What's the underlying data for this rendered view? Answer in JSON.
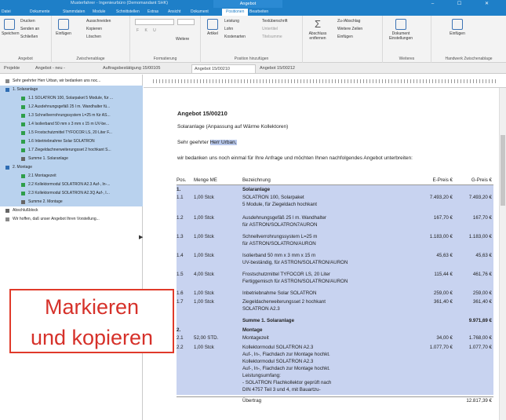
{
  "titlebar": {
    "title": "Musterfahrer - Ingenieurbüro (Demomandant SHK)",
    "context_tab": "Angebot",
    "window_controls": "–  ☐  ✕"
  },
  "tabs": [
    {
      "label": "Datei",
      "active": false
    },
    {
      "label": "Dokumente",
      "active": false
    },
    {
      "label": "Stammdaten",
      "active": false
    },
    {
      "label": "Module",
      "active": false
    },
    {
      "label": "Schnittstellen",
      "active": false
    },
    {
      "label": "Extras",
      "active": false
    },
    {
      "label": "Ansicht",
      "active": false
    },
    {
      "label": "Dokument",
      "active": false
    },
    {
      "label": "Positionen",
      "active": true
    },
    {
      "label": "Bearbeiten",
      "active": false
    }
  ],
  "ribbon": {
    "angebot": {
      "print": "Drucken",
      "send": "Senden an",
      "save": "Speichern",
      "close": "Schließen",
      "label": "Angebot"
    },
    "zwischenablage": {
      "cut": "Ausschneiden",
      "copy": "Kopieren",
      "paste": "Einfügen",
      "delete": "Löschen",
      "label": "Zwischenablage"
    },
    "formatierung": {
      "label": "Formatierung",
      "more": "Weitere"
    },
    "positionen": {
      "article": "Artikel",
      "leistung": "Leistung",
      "lohn": "Lohn",
      "kostenarten": "Kostenarten",
      "textueberschrift": "Textüberschrift",
      "untertitel": "Untertitel",
      "titelsumme": "Titelsumme",
      "label": "Position hinzufügen"
    },
    "abschluss": {
      "remove": "Abschluss entfernen",
      "zuabschlag": "Zu-/Abschlag",
      "weitere_zeilen": "Weitere Zeilen",
      "einfuegen": "Einfügen"
    },
    "weiteres": {
      "doc_settings": "Dokument Einstellungen",
      "label": "Weiteres"
    },
    "handwerk": {
      "paste": "Einfügen",
      "label": "Handwerk Zwischenablage"
    }
  },
  "doc_tabs": [
    {
      "label": "Projekte",
      "active": false
    },
    {
      "label": "Angebot - neu -",
      "active": false
    },
    {
      "label": "Auftragsbestätigung 15/00105",
      "active": false
    },
    {
      "label": "Angebot 15/00210",
      "active": true
    },
    {
      "label": "Angebot 15/00212",
      "active": false
    }
  ],
  "tree": [
    {
      "label": "Sehr geehrter Herr Urban, wir bedanken uns noc...",
      "level": 1,
      "sel": false,
      "icon": "text"
    },
    {
      "label": "1. Solaranlage",
      "level": 1,
      "sel": true,
      "icon": "group"
    },
    {
      "label": "1.1 SOLATRON 100, Solarpaket 5 Module, für ...",
      "level": 2,
      "sel": true,
      "icon": "article"
    },
    {
      "label": "1.2 Ausdehnungsgefäß 25 l m. Wandhalter fü...",
      "level": 2,
      "sel": true,
      "icon": "article"
    },
    {
      "label": "1.3 Schnellverrohrungssystem L=25 m für AS...",
      "level": 2,
      "sel": true,
      "icon": "article"
    },
    {
      "label": "1.4 Isolierband 50 mm x 3 mm x 15 m UV-be...",
      "level": 2,
      "sel": true,
      "icon": "article"
    },
    {
      "label": "1.5 Frostschutzmittel TYFOCOR LS, 20 Liter F...",
      "level": 2,
      "sel": true,
      "icon": "article"
    },
    {
      "label": "1.6 Inbetriebnahme Solar SOLATRON",
      "level": 2,
      "sel": true,
      "icon": "article"
    },
    {
      "label": "1.7 Ziegeldachnerweiterungsset 2 hochkant S...",
      "level": 2,
      "sel": true,
      "icon": "article"
    },
    {
      "label": "Summe 1. Solaranlage",
      "level": 2,
      "sel": true,
      "icon": "sum"
    },
    {
      "label": "2. Montage",
      "level": 1,
      "sel": true,
      "icon": "group"
    },
    {
      "label": "2.1 Montagezeit",
      "level": 2,
      "sel": true,
      "icon": "article"
    },
    {
      "label": "2.2 Kollektormodul SOLATRON A2.3 Auf-, In-...",
      "level": 2,
      "sel": true,
      "icon": "article"
    },
    {
      "label": "2.3 Kollektormodul SOLATRON A2.3Q Auf-, I...",
      "level": 2,
      "sel": true,
      "icon": "article"
    },
    {
      "label": "Summe 2. Montage",
      "level": 2,
      "sel": true,
      "icon": "sum"
    },
    {
      "label": "Abschlußblock",
      "level": 1,
      "sel": false,
      "icon": "sum"
    },
    {
      "label": "Wir hoffen, daß unser Angebot Ihren Vorstellung...",
      "level": 1,
      "sel": false,
      "icon": "text"
    }
  ],
  "document": {
    "title": "Angebot 15/00210",
    "subject": "Solaranlage (Anpassung auf Wärme Kollektoren)",
    "greeting_prefix": "Sehr geehrter ",
    "greeting_highlight": "Herr Urban,",
    "intro": "wir bedanken uns noch einmal für Ihre Anfrage und möchten Ihnen nachfolgendes Angebot unterbreiten:",
    "headers": {
      "pos": "Pos.",
      "menge": "Menge ME",
      "bez": "Bezeichnung",
      "ep": "E-Preis €",
      "gp": "G-Preis €"
    },
    "rows": [
      {
        "pos": "1.",
        "menge": "",
        "bez": [
          "Solaranlage"
        ],
        "ep": "",
        "gp": "",
        "bold": true,
        "h": 10
      },
      {
        "pos": "1.1",
        "menge": "1,00 Stck",
        "bez": [
          "SOLATRON 100, Solarpaket",
          "5 Module, für Ziegeldach hochkant"
        ],
        "ep": "7.493,20 €",
        "gp": "7.493,20 €",
        "bold": false,
        "h": 26
      },
      {
        "pos": "1.2",
        "menge": "1,00 Stck",
        "bez": [
          "Ausdehnungsgefäß 25 l m. Wandhalter",
          "für ASTRON/SOLATRON7AURON"
        ],
        "ep": "167,70 €",
        "gp": "167,70 €",
        "bold": false,
        "h": 24
      },
      {
        "pos": "1.3",
        "menge": "1,00 Stck",
        "bez": [
          "Schnellverrohrungssystem L=25 m",
          "für ASTRON/SOLATRON/AURON"
        ],
        "ep": "1.183,00 €",
        "gp": "1.183,00 €",
        "bold": false,
        "h": 24
      },
      {
        "pos": "1.4",
        "menge": "1,00 Stck",
        "bez": [
          "Isolierband 50 mm x 3 mm x 15 m",
          "UV-beständig, für ASTRON/SOLATRON/AURON"
        ],
        "ep": "45,63 €",
        "gp": "45,63 €",
        "bold": false,
        "h": 24
      },
      {
        "pos": "1.5",
        "menge": "4,00 Stck",
        "bez": [
          "Frostschutzmittel TYFOCOR LS, 20 Liter",
          "Fertiggemisch für ASTRON/SOLATRON/AURON"
        ],
        "ep": "115,44 €",
        "gp": "461,76 €",
        "bold": false,
        "h": 24
      },
      {
        "pos": "1.6",
        "menge": "1,00 Stck",
        "bez": [
          "Inbetriebnahme Solar SOLATRON"
        ],
        "ep": "259,00 €",
        "gp": "259,00 €",
        "bold": false,
        "h": 11
      },
      {
        "pos": "1.7",
        "menge": "1,00 Stck",
        "bez": [
          "Ziegeldacherweiterungsset 2 hochkant",
          "SOLATRON A2.3"
        ],
        "ep": "361,40 €",
        "gp": "361,40 €",
        "bold": false,
        "h": 24
      },
      {
        "pos": "",
        "menge": "",
        "bez": [
          "Summe 1. Solaranlage"
        ],
        "ep": "",
        "gp": "9.971,69 €",
        "bold": true,
        "h": 12
      },
      {
        "pos": "2.",
        "menge": "",
        "bez": [
          "Montage"
        ],
        "ep": "",
        "gp": "",
        "bold": true,
        "h": 10
      },
      {
        "pos": "2.1",
        "menge": "52,00 STD.",
        "bez": [
          "Montagezeit"
        ],
        "ep": "34,00 €",
        "gp": "1.768,00 €",
        "bold": false,
        "h": 12
      },
      {
        "pos": "2.2",
        "menge": "1,00 Stck",
        "bez": [
          "Kollektormodul SOLATRON A2.3",
          "Auf-, In-, Flachdach zur Montage hochkt.",
          "Kollektormodul SOLATRON A2.3",
          "Auf-, In-, Flachdach zur Montage hochkt.",
          "Leistungsumfang:",
          "- SOLATRON Flachkollektor geprüft nach",
          "  DIN 4757 Teil 3 und 4, mit Bauartzu-"
        ],
        "ep": "1.077,70 €",
        "gp": "1.077,70 €",
        "bold": false,
        "h": 66
      }
    ],
    "carry_label": "Übertrag",
    "carry_value": "12.817,39 €"
  },
  "overlay": {
    "line1": "Markieren",
    "line2": "und kopieren"
  },
  "colors": {
    "accent": "#1e7fc8",
    "selection": "#c8d3f0",
    "overlay_red": "#d6312a"
  }
}
